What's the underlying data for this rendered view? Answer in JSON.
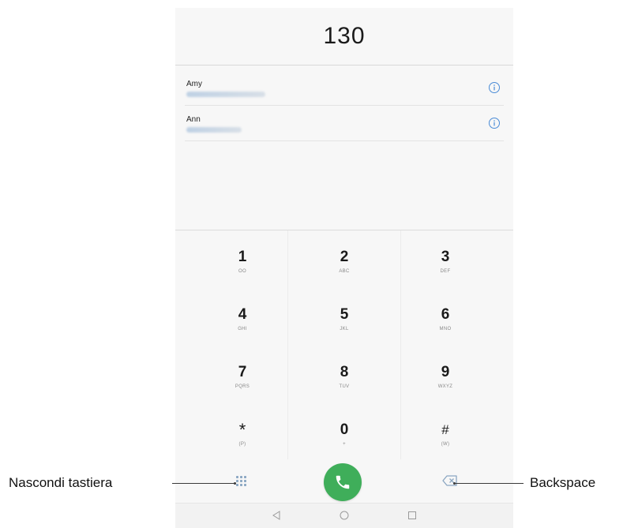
{
  "dialer": {
    "number": "130",
    "contacts": [
      {
        "name": "Amy"
      },
      {
        "name": "Ann"
      }
    ],
    "keys": [
      {
        "digit": "1",
        "letters": "OO"
      },
      {
        "digit": "2",
        "letters": "ABC"
      },
      {
        "digit": "3",
        "letters": "DEF"
      },
      {
        "digit": "4",
        "letters": "GHI"
      },
      {
        "digit": "5",
        "letters": "JKL"
      },
      {
        "digit": "6",
        "letters": "MNO"
      },
      {
        "digit": "7",
        "letters": "PQRS"
      },
      {
        "digit": "8",
        "letters": "TUV"
      },
      {
        "digit": "9",
        "letters": "WXYZ"
      },
      {
        "digit": "*",
        "letters": "(P)"
      },
      {
        "digit": "0",
        "letters": "+"
      },
      {
        "digit": "#",
        "letters": "(W)"
      }
    ]
  },
  "icons": {
    "contact_info": "info-icon",
    "hide_keyboard": "dialpad-icon",
    "call": "phone-icon",
    "backspace": "backspace-icon",
    "nav_back": "back-triangle-icon",
    "nav_home": "home-circle-icon",
    "nav_recents": "recents-square-icon"
  },
  "callouts": {
    "left": "Nascondi tastiera",
    "right": "Backspace"
  },
  "colors": {
    "call_button": "#3fae5a",
    "info_icon": "#4a8bd6",
    "accent_blue": "#8aa6c2"
  }
}
